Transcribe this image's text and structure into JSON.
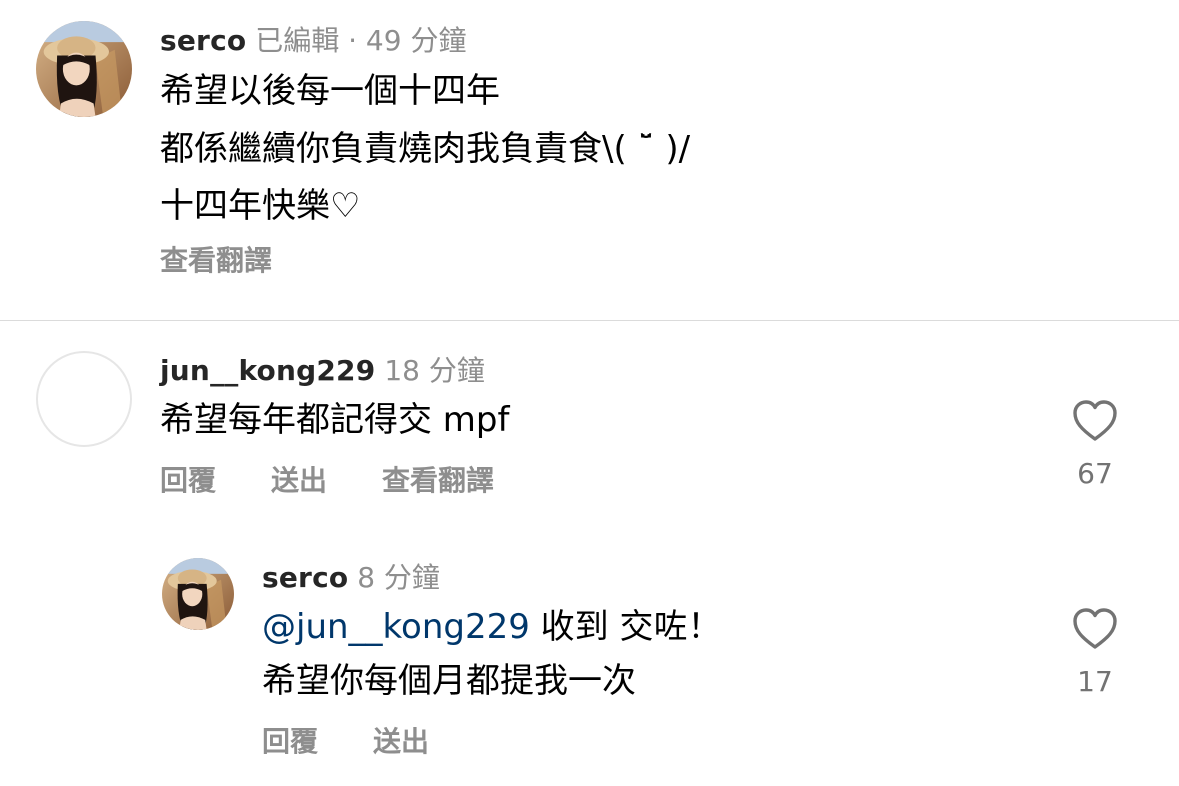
{
  "comments": [
    {
      "username": "serco",
      "meta": "已編輯 · 49 分鐘",
      "lines": [
        "希望以後每一個十四年",
        "都係繼續你負責燒肉我負責食\\( ˘̈ )/",
        "十四年快樂♡"
      ],
      "translate_label": "查看翻譯"
    },
    {
      "username": "jun__kong229",
      "meta": "18 分鐘",
      "text": "希望每年都記得交 mpf",
      "actions": {
        "reply": "回覆",
        "send": "送出",
        "translate": "查看翻譯"
      },
      "likes": "67"
    },
    {
      "username": "serco",
      "meta": "8 分鐘",
      "mention": "@jun__kong229",
      "text_after_mention": " 收到 交咗！",
      "line2": "希望你每個月都提我一次",
      "actions": {
        "reply": "回覆",
        "send": "送出"
      },
      "likes": "17"
    }
  ],
  "colors": {
    "username": "#262626",
    "meta": "#8e8e8e",
    "mention": "#00376b",
    "divider": "#dbdbdb"
  },
  "icons": {
    "like": "heart-outline-icon"
  }
}
